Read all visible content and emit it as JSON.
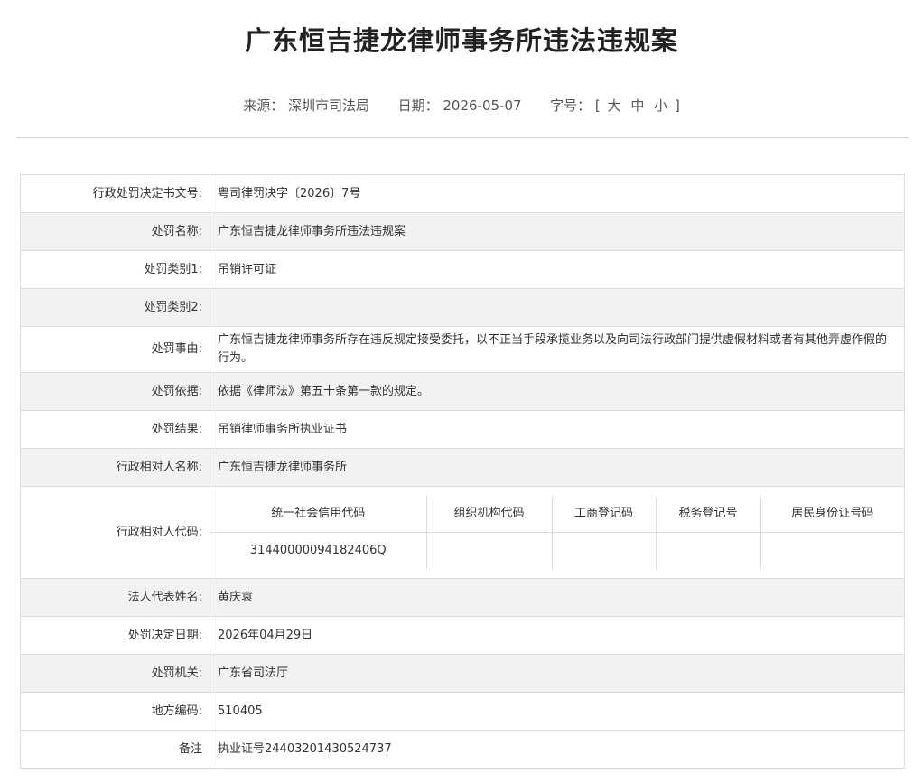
{
  "page": {
    "title": "广东恒吉捷龙律师事务所违法违规案"
  },
  "meta": {
    "source_label": "来源：",
    "source": "深圳市司法局",
    "date_label": "日期：",
    "date": "2026-05-07",
    "size_label": "字号：",
    "bracket_open": "[",
    "size_large": "大",
    "size_medium": "中",
    "size_small": "小",
    "bracket_close": "]"
  },
  "rows": {
    "doc_no": {
      "label": "行政处罚决定书文号:",
      "value": "粤司律罚决字〔2026〕7号"
    },
    "name": {
      "label": "处罚名称:",
      "value": "广东恒吉捷龙律师事务所违法违规案"
    },
    "type1": {
      "label": "处罚类别1:",
      "value": "吊销许可证"
    },
    "type2": {
      "label": "处罚类别2:",
      "value": ""
    },
    "reason": {
      "label": "处罚事由:",
      "value": "广东恒吉捷龙律师事务所存在违反规定接受委托，以不正当手段承揽业务以及向司法行政部门提供虚假材料或者有其他弄虚作假的行为。"
    },
    "basis": {
      "label": "处罚依据:",
      "value": "依据《律师法》第五十条第一款的规定。"
    },
    "result": {
      "label": "处罚结果:",
      "value": "吊销律师事务所执业证书"
    },
    "party_name": {
      "label": "行政相对人名称:",
      "value": "广东恒吉捷龙律师事务所"
    },
    "party_code": {
      "label": "行政相对人代码:",
      "headers": [
        "统一社会信用代码",
        "组织机构代码",
        "工商登记码",
        "税务登记号",
        "居民身份证号码"
      ],
      "values": [
        "31440000094182406Q",
        "",
        "",
        "",
        ""
      ]
    },
    "legal_rep": {
      "label": "法人代表姓名:",
      "value": "黄庆袁"
    },
    "decision_date": {
      "label": "处罚决定日期:",
      "value": "2026年04月29日"
    },
    "authority": {
      "label": "处罚机关:",
      "value": "广东省司法厅"
    },
    "region_code": {
      "label": "地方编码:",
      "value": "510405"
    },
    "remark": {
      "label": "备注",
      "value": "执业证号24403201430524737"
    }
  }
}
